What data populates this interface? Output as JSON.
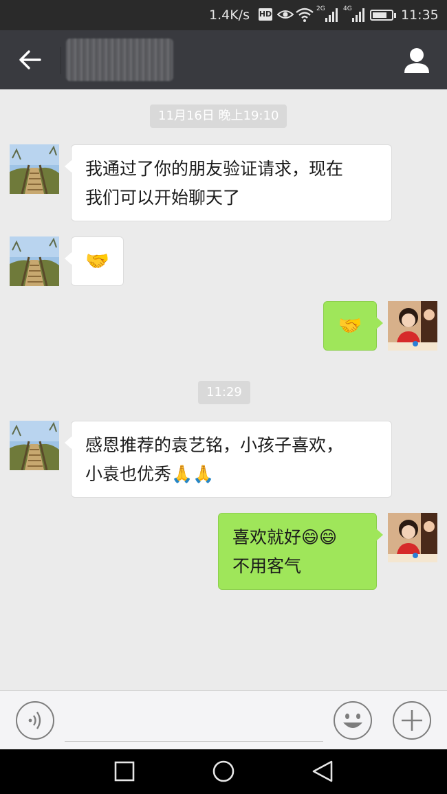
{
  "status_bar": {
    "network_speed": "1.4K/s",
    "hd_label": "HD",
    "net1_label": "2G",
    "net2_label": "4G",
    "time": "11:35",
    "battery_level": 0.75
  },
  "header": {
    "back_icon": "arrow-left-icon",
    "profile_icon": "person-icon"
  },
  "chat": {
    "timestamp_1": "11月16日 晚上19:10",
    "timestamp_2": "11:29",
    "messages": [
      {
        "side": "in",
        "lines": [
          "我通过了你的朋友验证请求，现在",
          "我们可以开始聊天了"
        ]
      },
      {
        "side": "in",
        "emoji": "🤝"
      },
      {
        "side": "out",
        "emoji": "🤝"
      },
      {
        "side": "in",
        "lines": [
          "感恩推荐的袁艺铭，小孩子喜欢，",
          "小袁也优秀🙏🙏"
        ]
      },
      {
        "side": "out",
        "lines": [
          "喜欢就好😄😄",
          "不用客气"
        ]
      }
    ]
  },
  "input_bar": {
    "voice_icon": "voice-icon",
    "emoji_icon": "smiley-icon",
    "plus_icon": "plus-icon",
    "input_value": ""
  },
  "nav_bar": {
    "back_icon": "triangle-back-icon",
    "home_icon": "circle-home-icon",
    "recent_icon": "square-recent-icon"
  },
  "colors": {
    "header_bg": "#393a3f",
    "chat_bg": "#ebebeb",
    "bubble_out": "#9fe65a",
    "bubble_in": "#ffffff"
  }
}
